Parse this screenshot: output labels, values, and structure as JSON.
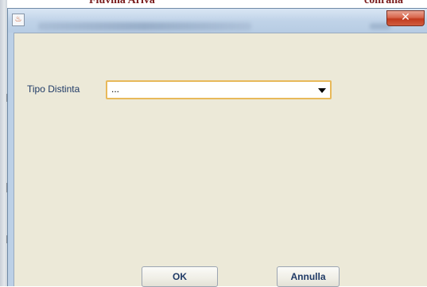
{
  "background": {
    "text_left": "Fiuvina Ariva",
    "text_right": "conrana"
  },
  "dialog": {
    "close_label": "✕",
    "tipo_label": "Tipo Distinta",
    "tipo_value": "...",
    "ok_label": "OK",
    "cancel_label": "Annulla"
  },
  "colors": {
    "client_bg": "#ece9d8",
    "label_text": "#1f3a66",
    "combo_focus_border": "#e8b95a",
    "close_button": "#c13a1e"
  }
}
